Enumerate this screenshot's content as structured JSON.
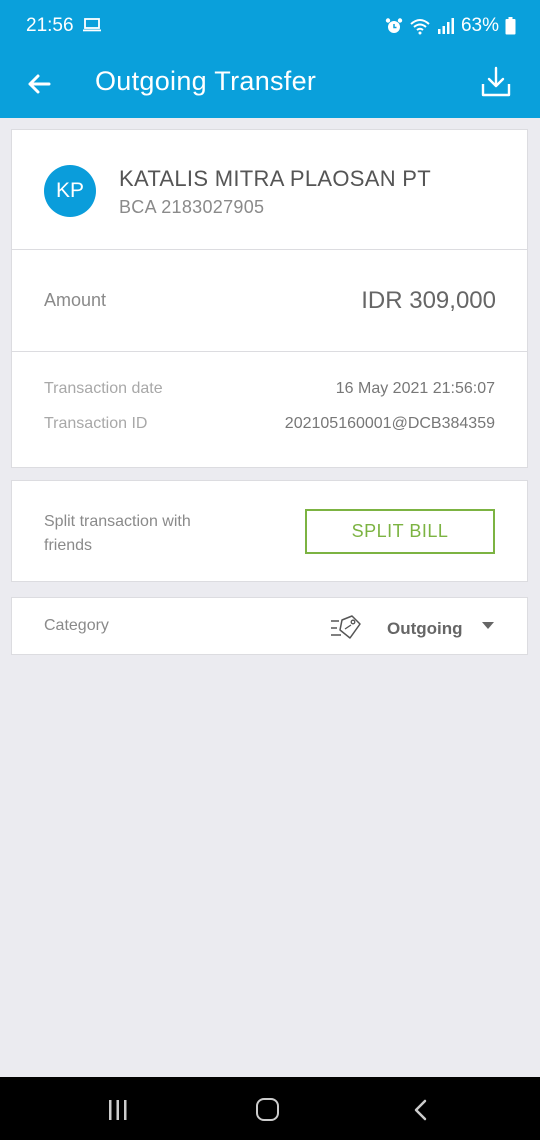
{
  "status_bar": {
    "time": "21:56",
    "battery": "63%",
    "icons": [
      "laptop-icon",
      "alarm-icon",
      "wifi-icon",
      "signal-icon",
      "battery-icon"
    ]
  },
  "app_bar": {
    "title": "Outgoing Transfer",
    "back_icon": "arrow-left-icon",
    "download_icon": "download-icon"
  },
  "payee": {
    "initials": "KP",
    "name": "KATALIS MITRA PLAOSAN PT",
    "account": "BCA 2183027905"
  },
  "amount": {
    "label": "Amount",
    "value": "IDR 309,000"
  },
  "details": [
    {
      "label": "Transaction date",
      "value": "16 May 2021 21:56:07"
    },
    {
      "label": "Transaction ID",
      "value": "202105160001@DCB384359"
    }
  ],
  "split": {
    "text": "Split transaction with friends",
    "button_label": "SPLIT BILL"
  },
  "category": {
    "label": "Category",
    "value": "Outgoing",
    "icon": "tag-icon"
  },
  "colors": {
    "primary": "#0aa0db",
    "accent_green": "#7cb342",
    "background": "#ebebf0"
  }
}
